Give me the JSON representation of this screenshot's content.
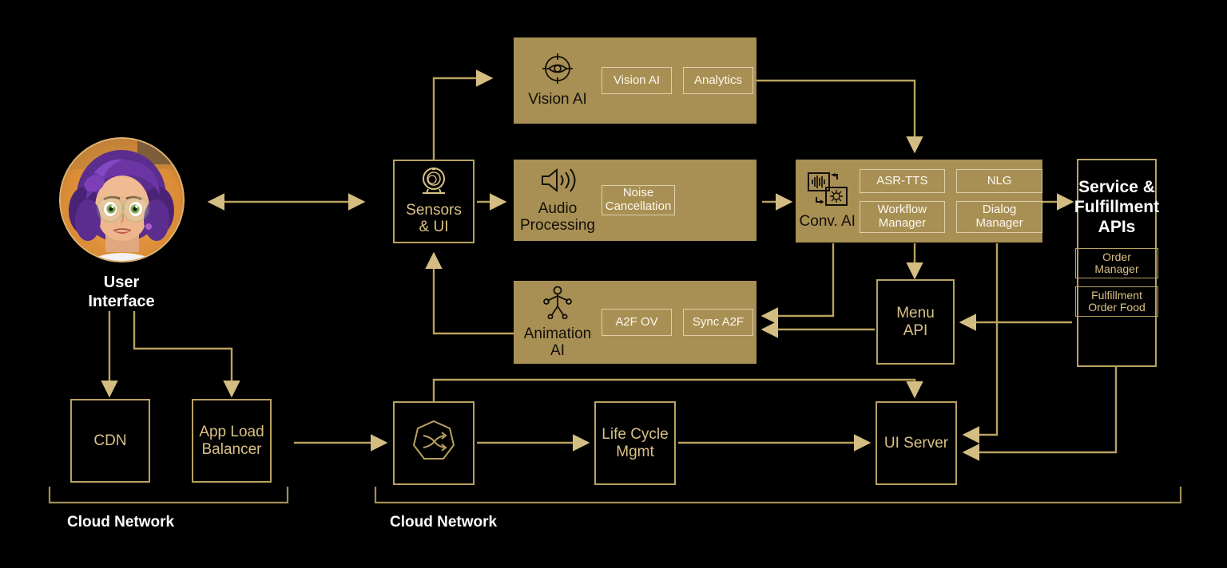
{
  "colors": {
    "background": "#000000",
    "gold_line": "#b9a25f",
    "gold_text": "#d9c184",
    "panel_fill": "#a89054",
    "chip_text": "#fdf8ee",
    "white_text": "#ffffff"
  },
  "user": {
    "label_line1": "User",
    "label_line2": "Interface",
    "avatar_icon": "user-avatar-photo"
  },
  "sensors": {
    "label_line1": "Sensors",
    "label_line2": "& UI",
    "icon": "webcam-icon"
  },
  "panels": [
    {
      "id": "vision-ai",
      "label": "Vision AI",
      "icon": "eye-target-icon",
      "chips": [
        "Vision AI",
        "Analytics"
      ]
    },
    {
      "id": "audio-processing",
      "label_line1": "Audio",
      "label_line2": "Processing",
      "icon": "speaker-waves-icon",
      "chips": [
        "Noise Cancellation"
      ]
    },
    {
      "id": "animation-ai",
      "label_line1": "Animation",
      "label_line2": "AI",
      "icon": "body-rig-icon",
      "chips": [
        "A2F OV",
        "Sync A2F"
      ]
    },
    {
      "id": "conversational-ai",
      "label": "Conv. AI",
      "icon": "waveform-neural-icon",
      "chips": [
        "ASR-TTS",
        "NLG",
        "Workflow Manager",
        "Dialog Manager"
      ]
    }
  ],
  "service_apis": {
    "title_line1": "Service &",
    "title_line2": "Fulfillment",
    "title_line3": "APIs",
    "subchips": [
      "Order Manager",
      "Fulfillment Order Food"
    ]
  },
  "menu_api": {
    "label_line1": "Menu",
    "label_line2": "API"
  },
  "infra": {
    "cdn": "CDN",
    "alb_line1": "App Load",
    "alb_line2": "Balancer",
    "router_icon": "shuffle-heptagon-icon",
    "lifecycle_line1": "Life Cycle",
    "lifecycle_line2": "Mgmt",
    "ui_server": "UI Server"
  },
  "captions": {
    "cloud_left": "Cloud Network",
    "cloud_right": "Cloud Network"
  }
}
